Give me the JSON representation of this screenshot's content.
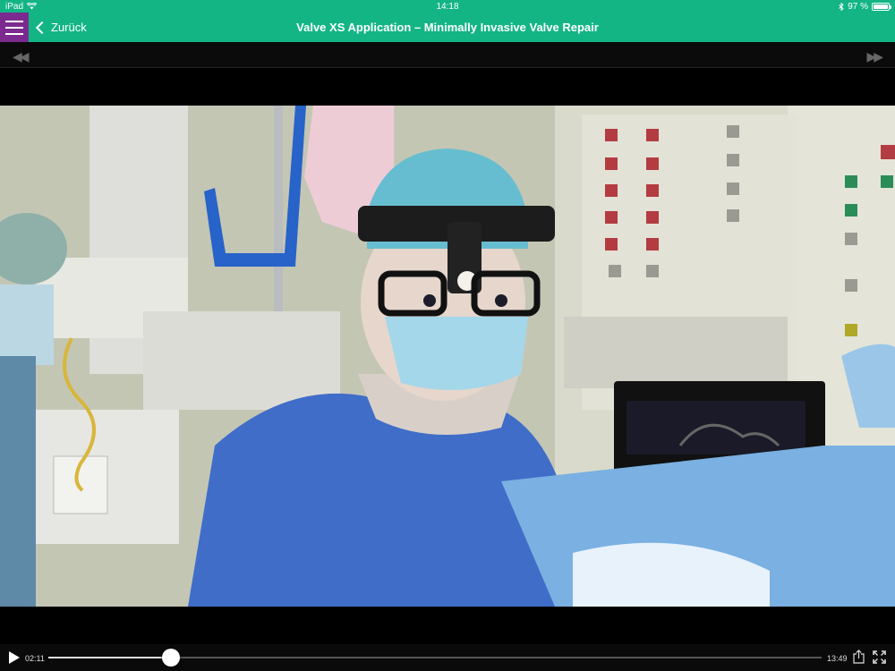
{
  "status_bar": {
    "device": "iPad",
    "time": "14:18",
    "battery": "97 %",
    "battery_level": 0.97,
    "icons": [
      "wifi-icon",
      "bluetooth-icon",
      "battery-icon"
    ]
  },
  "nav": {
    "back_label": "Zurück",
    "title": "Valve XS Application – Minimally Invasive Valve Repair",
    "menu_icon": "hamburger-menu-icon",
    "brand_color": "#13b585",
    "menu_color": "#7c2a8f"
  },
  "skip_bar": {
    "back_icon": "rewind-icon",
    "forward_icon": "fast-forward-icon"
  },
  "video": {
    "description_icon": "video-frame"
  },
  "player": {
    "elapsed": "02:11",
    "total": "13:49",
    "progress": 0.158,
    "icons": [
      "play-icon",
      "share-icon",
      "fullscreen-icon"
    ]
  }
}
